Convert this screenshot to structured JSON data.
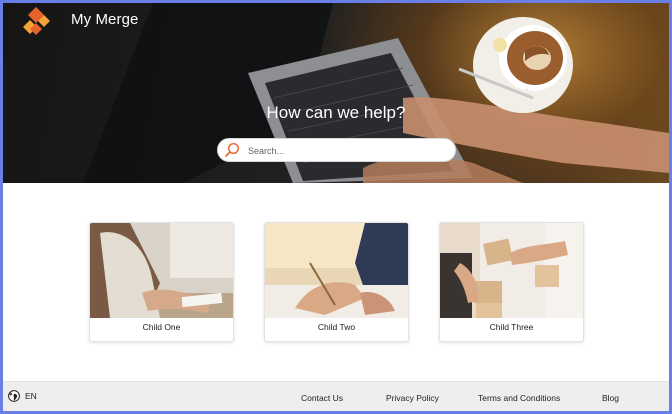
{
  "header": {
    "site_title": "My Merge",
    "logo_colors": [
      "#e8632b",
      "#f4a236"
    ]
  },
  "hero": {
    "heading": "How can we help?",
    "search": {
      "placeholder": "Search...",
      "value": ""
    }
  },
  "cards": [
    {
      "label": "Child One"
    },
    {
      "label": "Child Two"
    },
    {
      "label": "Child Three"
    }
  ],
  "footer": {
    "language": "EN",
    "links": [
      "Contact Us",
      "Privacy Policy",
      "Terms and Conditions",
      "Blog"
    ]
  },
  "colors": {
    "accent": "#e8632b",
    "frame_border": "#6a7fe6",
    "footer_bg": "#eeeeee"
  }
}
